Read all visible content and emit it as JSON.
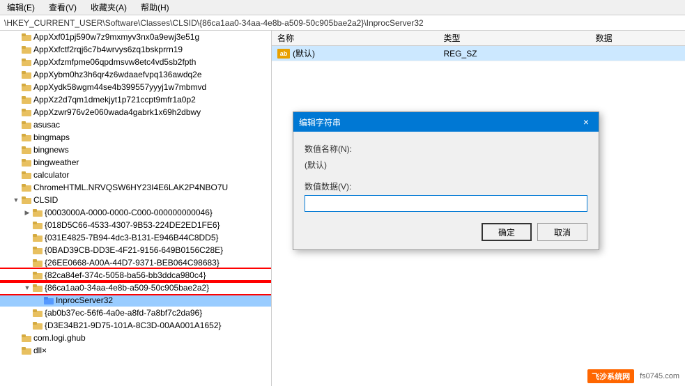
{
  "menubar": {
    "items": [
      "编辑(E)",
      "查看(V)",
      "收藏夹(A)",
      "帮助(H)"
    ]
  },
  "addressbar": {
    "path": "\\HKEY_CURRENT_USER\\Software\\Classes\\CLSID\\{86ca1aa0-34aa-4e8b-a509-50c905bae2a2}\\InprocServer32"
  },
  "tree": {
    "items": [
      {
        "id": "app1",
        "label": "AppXxf01pj590w7z9mxmyv3nx0a9ewj3e51g",
        "depth": 1,
        "hasArrow": false,
        "expanded": false,
        "selected": false,
        "highlighted": false
      },
      {
        "id": "app2",
        "label": "AppXxfctf2rqj6c7b4wrvys6zq1bskprrn19",
        "depth": 1,
        "hasArrow": false,
        "expanded": false,
        "selected": false,
        "highlighted": false
      },
      {
        "id": "app3",
        "label": "AppXxfzmfpme06qpdmsvw8etc4vd5sb2fpth",
        "depth": 1,
        "hasArrow": false,
        "expanded": false,
        "selected": false,
        "highlighted": false
      },
      {
        "id": "app4",
        "label": "AppXybm0hz3h6qr4z6wdaaefvpq136awdq2e",
        "depth": 1,
        "hasArrow": false,
        "expanded": false,
        "selected": false,
        "highlighted": false
      },
      {
        "id": "app5",
        "label": "AppXydk58wgm44se4b399557yyyj1w7mbmvd",
        "depth": 1,
        "hasArrow": false,
        "expanded": false,
        "selected": false,
        "highlighted": false
      },
      {
        "id": "app6",
        "label": "AppXz2d7qm1dmekjyt1p721ccpt9mfr1a0p2",
        "depth": 1,
        "hasArrow": false,
        "expanded": false,
        "selected": false,
        "highlighted": false
      },
      {
        "id": "app7",
        "label": "AppXzwr976v2e060wada4gabrk1x69h2dbwy",
        "depth": 1,
        "hasArrow": false,
        "expanded": false,
        "selected": false,
        "highlighted": false
      },
      {
        "id": "asusac",
        "label": "asusac",
        "depth": 1,
        "hasArrow": false,
        "expanded": false,
        "selected": false,
        "highlighted": false
      },
      {
        "id": "bingmaps",
        "label": "bingmaps",
        "depth": 1,
        "hasArrow": false,
        "expanded": false,
        "selected": false,
        "highlighted": false
      },
      {
        "id": "bingnews",
        "label": "bingnews",
        "depth": 1,
        "hasArrow": false,
        "expanded": false,
        "selected": false,
        "highlighted": false
      },
      {
        "id": "bingweather",
        "label": "bingweather",
        "depth": 1,
        "hasArrow": false,
        "expanded": false,
        "selected": false,
        "highlighted": false
      },
      {
        "id": "calculator",
        "label": "calculator",
        "depth": 1,
        "hasArrow": false,
        "expanded": false,
        "selected": false,
        "highlighted": false
      },
      {
        "id": "chrome",
        "label": "ChromeHTML.NRVQSW6HY23I4E6LAK2P4NBO7U",
        "depth": 1,
        "hasArrow": false,
        "expanded": false,
        "selected": false,
        "highlighted": false
      },
      {
        "id": "clsid",
        "label": "CLSID",
        "depth": 1,
        "hasArrow": true,
        "expanded": true,
        "selected": false,
        "highlighted": false
      },
      {
        "id": "clsid1",
        "label": "{0003000A-0000-0000-C000-000000000046}",
        "depth": 2,
        "hasArrow": true,
        "expanded": false,
        "selected": false,
        "highlighted": false
      },
      {
        "id": "clsid2",
        "label": "{018D5C66-4533-4307-9B53-224DE2ED1FE6}",
        "depth": 2,
        "hasArrow": false,
        "expanded": false,
        "selected": false,
        "highlighted": false
      },
      {
        "id": "clsid3",
        "label": "{031E4825-7B94-4dc3-B131-E946B44C8DD5}",
        "depth": 2,
        "hasArrow": false,
        "expanded": false,
        "selected": false,
        "highlighted": false
      },
      {
        "id": "clsid4",
        "label": "{0BAD39CB-DD3E-4F21-9156-649B0156C28E}",
        "depth": 2,
        "hasArrow": false,
        "expanded": false,
        "selected": false,
        "highlighted": false
      },
      {
        "id": "clsid5",
        "label": "{26EE0668-A00A-44D7-9371-BEB064C98683}",
        "depth": 2,
        "hasArrow": false,
        "expanded": false,
        "selected": false,
        "highlighted": false
      },
      {
        "id": "clsid6",
        "label": "{82ca84ef-374c-5058-ba56-bb3ddca980c4}",
        "depth": 2,
        "hasArrow": false,
        "expanded": false,
        "selected": false,
        "highlighted": true
      },
      {
        "id": "clsid7",
        "label": "{86ca1aa0-34aa-4e8b-a509-50c905bae2a2}",
        "depth": 2,
        "hasArrow": true,
        "expanded": true,
        "selected": false,
        "highlighted": true
      },
      {
        "id": "inproc",
        "label": "InprocServer32",
        "depth": 3,
        "hasArrow": false,
        "expanded": false,
        "selected": true,
        "highlighted": false
      },
      {
        "id": "clsid8",
        "label": "{ab0b37ec-56f6-4a0e-a8fd-7a8bf7c2da96}",
        "depth": 2,
        "hasArrow": false,
        "expanded": false,
        "selected": false,
        "highlighted": false
      },
      {
        "id": "clsid9",
        "label": "{D3E34B21-9D75-101A-8C3D-00AA001A1652}",
        "depth": 2,
        "hasArrow": false,
        "expanded": false,
        "selected": false,
        "highlighted": false
      },
      {
        "id": "comlogi",
        "label": "com.logi.ghub",
        "depth": 1,
        "hasArrow": false,
        "expanded": false,
        "selected": false,
        "highlighted": false
      },
      {
        "id": "dllx",
        "label": "dll×",
        "depth": 1,
        "hasArrow": false,
        "expanded": false,
        "selected": false,
        "highlighted": false
      }
    ]
  },
  "registry_table": {
    "columns": [
      "名称",
      "类型",
      "数据"
    ],
    "rows": [
      {
        "name": "(默认)",
        "type": "REG_SZ",
        "data": ""
      }
    ]
  },
  "dialog": {
    "title": "编辑字符串",
    "close_label": "×",
    "name_label": "数值名称(N):",
    "name_value": "(默认)",
    "data_label": "数值数据(V):",
    "data_value": "",
    "ok_label": "确定",
    "cancel_label": "取消"
  },
  "watermark": {
    "logo": "飞沙系统网",
    "url": "fs0745.com"
  }
}
